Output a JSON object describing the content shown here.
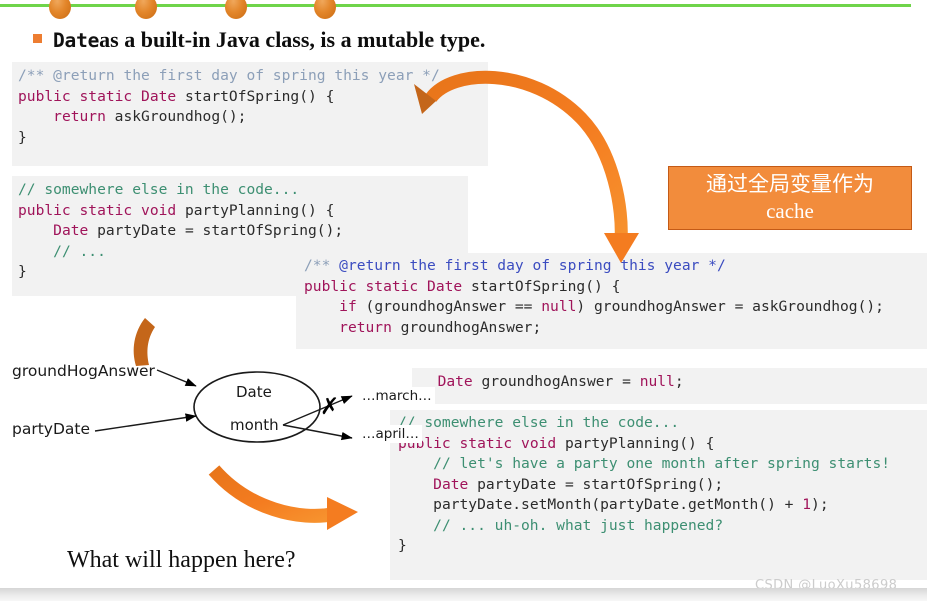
{
  "slide": {
    "heading": {
      "code_word": "Date",
      "rest": " as a built-in Java class, is a mutable type."
    },
    "question": "What will happen here?",
    "watermark": "CSDN @LuoXu58698"
  },
  "decor": {
    "line_color": "#6fd44a",
    "dot_color": "#e3862a",
    "dot_count": 4,
    "dot_positions": [
      60,
      146,
      236,
      325
    ]
  },
  "callout": {
    "line1": "通过全局变量作为",
    "line2": "cache",
    "bg": "#f28c3c",
    "border": "#c45a16",
    "text_color": "#ffffff"
  },
  "code_blocks": [
    {
      "id": "code1",
      "lines": [
        "/** @return the first day of spring this year */",
        "public static Date startOfSpring() {",
        "    return askGroundhog();",
        "}"
      ]
    },
    {
      "id": "code2",
      "lines": [
        "// somewhere else in the code...",
        "public static void partyPlanning() {",
        "    Date partyDate = startOfSpring();",
        "    // ...",
        "}"
      ]
    },
    {
      "id": "code3",
      "lines": [
        "/** @return the first day of spring this year */",
        "public static Date startOfSpring() {",
        "    if (groundhogAnswer == null) groundhogAnswer = askGroundhog();",
        "    return groundhogAnswer;"
      ]
    },
    {
      "id": "code4",
      "lines": [
        "  Date groundhogAnswer = null;"
      ]
    },
    {
      "id": "code5",
      "lines": [
        "// somewhere else in the code...",
        "public static void partyPlanning() {",
        "    // let's have a party one month after spring starts!",
        "    Date partyDate = startOfSpring();",
        "    partyDate.setMonth(partyDate.getMonth() + 1);",
        "    // ... uh-oh. what just happened?",
        "}"
      ]
    }
  ],
  "diagram": {
    "var1": "groundHogAnswer",
    "var2": "partyDate",
    "object_type": "Date",
    "object_field": "month",
    "value_old": "…march…",
    "value_new": "…april…",
    "cross_mark": "✗"
  },
  "arrows": {
    "big_curved_color": "#f47c20",
    "small_stub_color": "#c4661a",
    "bottom_curved_color": "#f47c20"
  }
}
